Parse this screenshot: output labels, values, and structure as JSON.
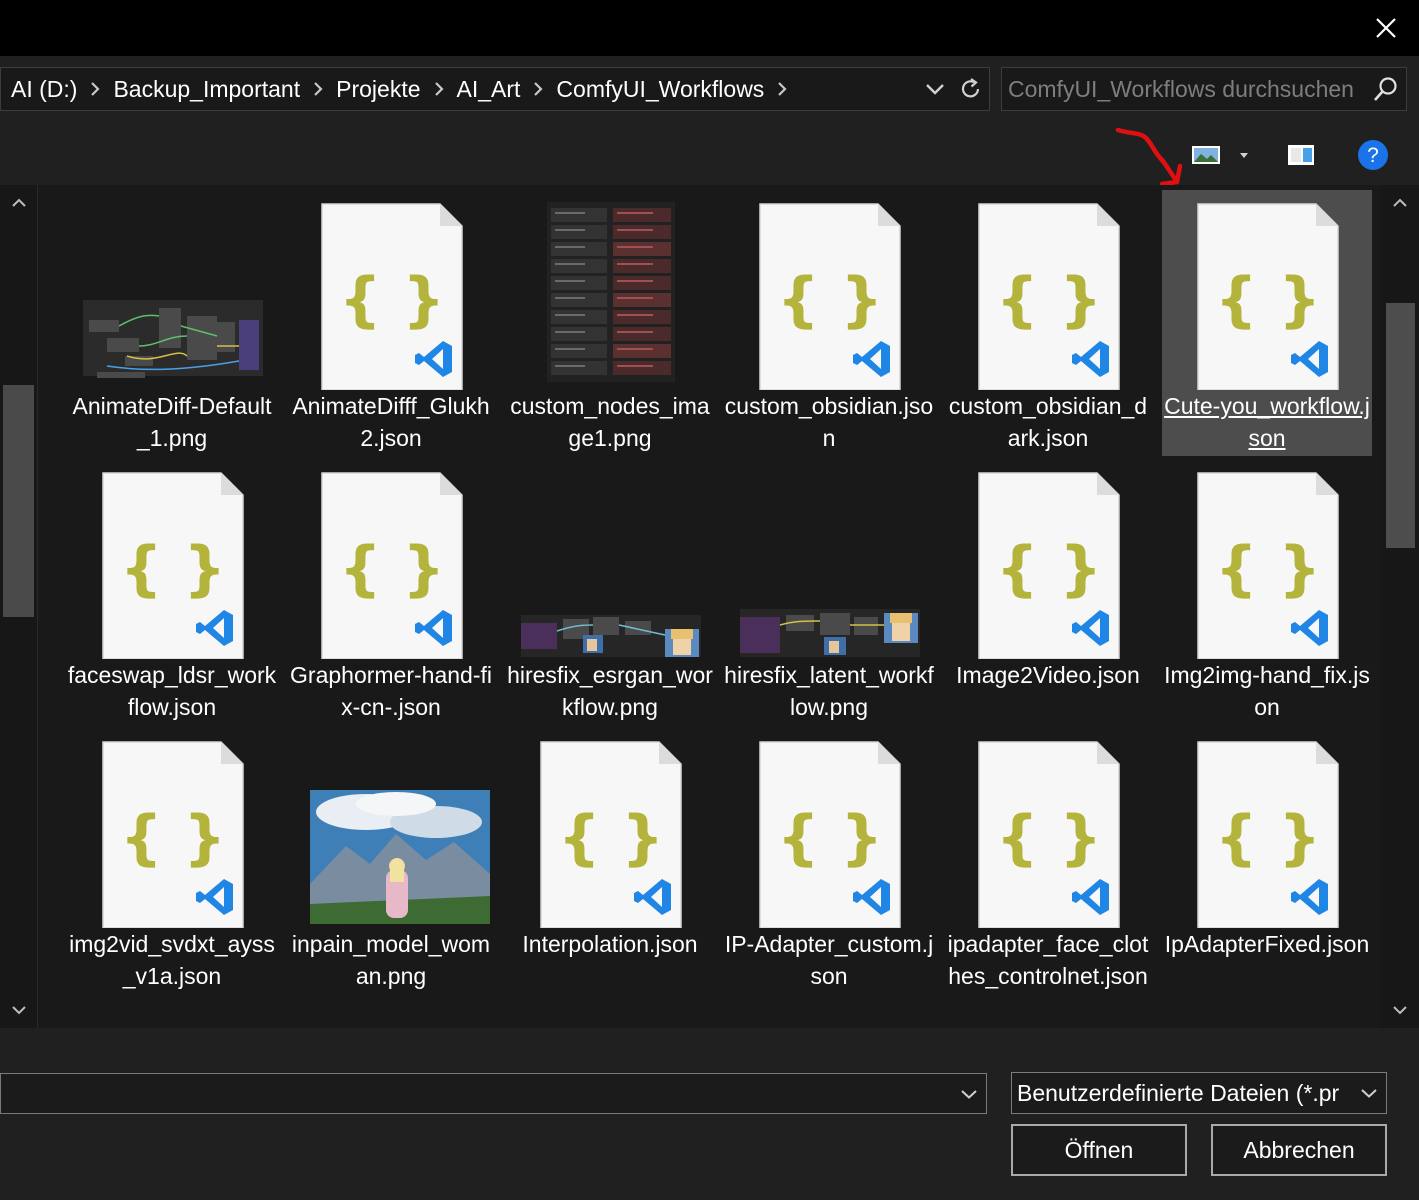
{
  "window": {
    "close_icon": "close-icon"
  },
  "address_bar": {
    "breadcrumbs": [
      "AI (D:)",
      "Backup_Important",
      "Projekte",
      "AI_Art",
      "ComfyUI_Workflows"
    ]
  },
  "search": {
    "placeholder": "ComfyUI_Workflows durchsuchen"
  },
  "toolbar": {
    "view_icon": "change-view-icon",
    "preview_pane_icon": "preview-pane-icon",
    "help_icon": "help-icon",
    "help_glyph": "?"
  },
  "files": [
    {
      "name": "AnimateDiff-Default_1.png",
      "kind": "png",
      "selected": false
    },
    {
      "name": "AnimateDifff_Glukh2.json",
      "kind": "json",
      "selected": false
    },
    {
      "name": "custom_nodes_image1.png",
      "kind": "png",
      "selected": false
    },
    {
      "name": "custom_obsidian.json",
      "kind": "json",
      "selected": false
    },
    {
      "name": "custom_obsidian_dark.json",
      "kind": "json",
      "selected": false
    },
    {
      "name": "Cute-you_workflow.json",
      "kind": "json",
      "selected": true
    },
    {
      "name": "faceswap_ldsr_workflow.json",
      "kind": "json",
      "selected": false
    },
    {
      "name": "Graphormer-hand-fix-cn-.json",
      "kind": "json",
      "selected": false
    },
    {
      "name": "hiresfix_esrgan_workflow.png",
      "kind": "png",
      "selected": false
    },
    {
      "name": "hiresfix_latent_workflow.png",
      "kind": "png",
      "selected": false
    },
    {
      "name": "Image2Video.json",
      "kind": "json",
      "selected": false
    },
    {
      "name": "Img2img-hand_fix.json",
      "kind": "json",
      "selected": false
    },
    {
      "name": "img2vid_svdxt_ayss_v1a.json",
      "kind": "json",
      "selected": false
    },
    {
      "name": "inpain_model_woman.png",
      "kind": "png",
      "selected": false
    },
    {
      "name": "Interpolation.json",
      "kind": "json",
      "selected": false
    },
    {
      "name": "IP-Adapter_custom.json",
      "kind": "json",
      "selected": false
    },
    {
      "name": "ipadapter_face_clothes_controlnet.json",
      "kind": "json",
      "selected": false
    },
    {
      "name": "IpAdapterFixed.json",
      "kind": "json",
      "selected": false
    }
  ],
  "json_icon": {
    "braces_glyph": "{ }"
  },
  "footer": {
    "filename_value": "",
    "filter_label": "Benutzerdefinierte Dateien (*.pr",
    "open_label": "Öffnen",
    "cancel_label": "Abbrechen"
  },
  "colors": {
    "background": "#191919",
    "panel": "#202020",
    "selection": "#4d4d4d",
    "json_braces": "#b4b43c",
    "vscode_blue": "#1f86e5",
    "help_blue": "#1a73e8",
    "annotation_arrow": "#e01010"
  }
}
